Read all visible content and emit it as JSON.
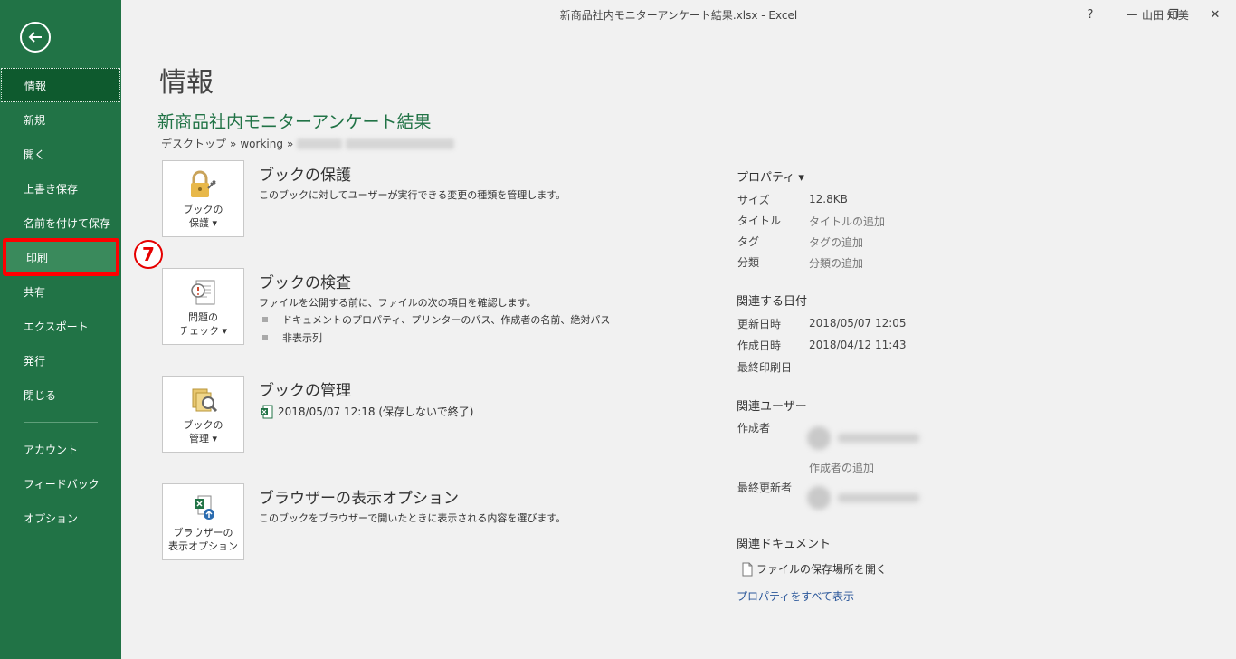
{
  "window": {
    "title": "新商品社内モニターアンケート結果.xlsx  -  Excel",
    "user": "山田 知美",
    "help": "?",
    "minimize": "—",
    "restore": "❐",
    "close": "✕"
  },
  "sidebar": {
    "items": [
      {
        "label": "情報"
      },
      {
        "label": "新規"
      },
      {
        "label": "開く"
      },
      {
        "label": "上書き保存"
      },
      {
        "label": "名前を付けて保存"
      },
      {
        "label": "印刷"
      },
      {
        "label": "共有"
      },
      {
        "label": "エクスポート"
      },
      {
        "label": "発行"
      },
      {
        "label": "閉じる"
      },
      {
        "label": "アカウント"
      },
      {
        "label": "フィードバック"
      },
      {
        "label": "オプション"
      }
    ],
    "colors": {
      "background": "#217346",
      "active": "#0e5a2e",
      "highlight_border": "#ff0000"
    }
  },
  "annotation": {
    "step": "7"
  },
  "main": {
    "title": "情報",
    "doc_name": "新商品社内モニターアンケート結果",
    "breadcrumb": [
      "デスクトップ",
      "»",
      "working",
      "»"
    ],
    "sections": [
      {
        "button_label": "ブックの\n保護 ▾",
        "heading": "ブックの保護",
        "desc": "このブックに対してユーザーが実行できる変更の種類を管理します。"
      },
      {
        "button_label": "問題の\nチェック ▾",
        "heading": "ブックの検査",
        "desc": "ファイルを公開する前に、ファイルの次の項目を確認します。",
        "bullets": [
          "ドキュメントのプロパティ、プリンターのパス、作成者の名前、絶対パス",
          "非表示列"
        ]
      },
      {
        "button_label": "ブックの\n管理 ▾",
        "heading": "ブックの管理",
        "desc": "2018/05/07 12:18 (保存しないで終了)"
      },
      {
        "button_label": "ブラウザーの\n表示オプション",
        "heading": "ブラウザーの表示オプション",
        "desc": "このブックをブラウザーで開いたときに表示される内容を選びます。"
      }
    ]
  },
  "properties": {
    "heading": "プロパティ ▾",
    "rows": [
      {
        "key": "サイズ",
        "value": "12.8KB"
      },
      {
        "key": "タイトル",
        "value": "タイトルの追加"
      },
      {
        "key": "タグ",
        "value": "タグの追加"
      },
      {
        "key": "分類",
        "value": "分類の追加"
      }
    ],
    "dates_heading": "関連する日付",
    "dates": [
      {
        "key": "更新日時",
        "value": "2018/05/07 12:05"
      },
      {
        "key": "作成日時",
        "value": "2018/04/12 11:43"
      },
      {
        "key": "最終印刷日",
        "value": ""
      }
    ],
    "users_heading": "関連ユーザー",
    "author_key": "作成者",
    "add_author": "作成者の追加",
    "last_modified_key": "最終更新者",
    "docs_heading": "関連ドキュメント",
    "open_location": "ファイルの保存場所を開く",
    "show_all": "プロパティをすべて表示"
  }
}
